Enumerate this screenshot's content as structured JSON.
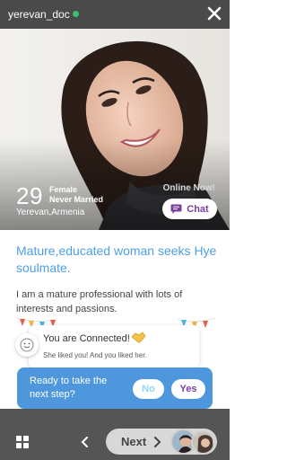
{
  "header": {
    "username": "yerevan_doc",
    "online_dot_color": "#3ec16a",
    "close_icon": "close-icon"
  },
  "profile": {
    "age": "29",
    "gender": "Female",
    "marital_status": "Never Married",
    "location": "Yerevan,Armenia",
    "online_status": "Online Now!",
    "chat_label": "Chat",
    "headline": "Mature,educated woman seeks Hye soulmate.",
    "description": "I am a mature professional with lots of interests and passions."
  },
  "match_popup": {
    "title": "You are Connected!",
    "subtitle": "She liked you! And you liked her.",
    "icon": "handshake-icon"
  },
  "next_step": {
    "question": "Ready to take the next step?",
    "no_label": "No",
    "yes_label": "Yes"
  },
  "bottom_bar": {
    "next_label": "Next",
    "icons": [
      "grid-icon",
      "chevron-left-icon",
      "chevron-right-icon"
    ]
  },
  "colors": {
    "accent_purple": "#7b3ea6",
    "accent_blue": "#4f97dc",
    "headline_blue": "#4d9fe6"
  }
}
